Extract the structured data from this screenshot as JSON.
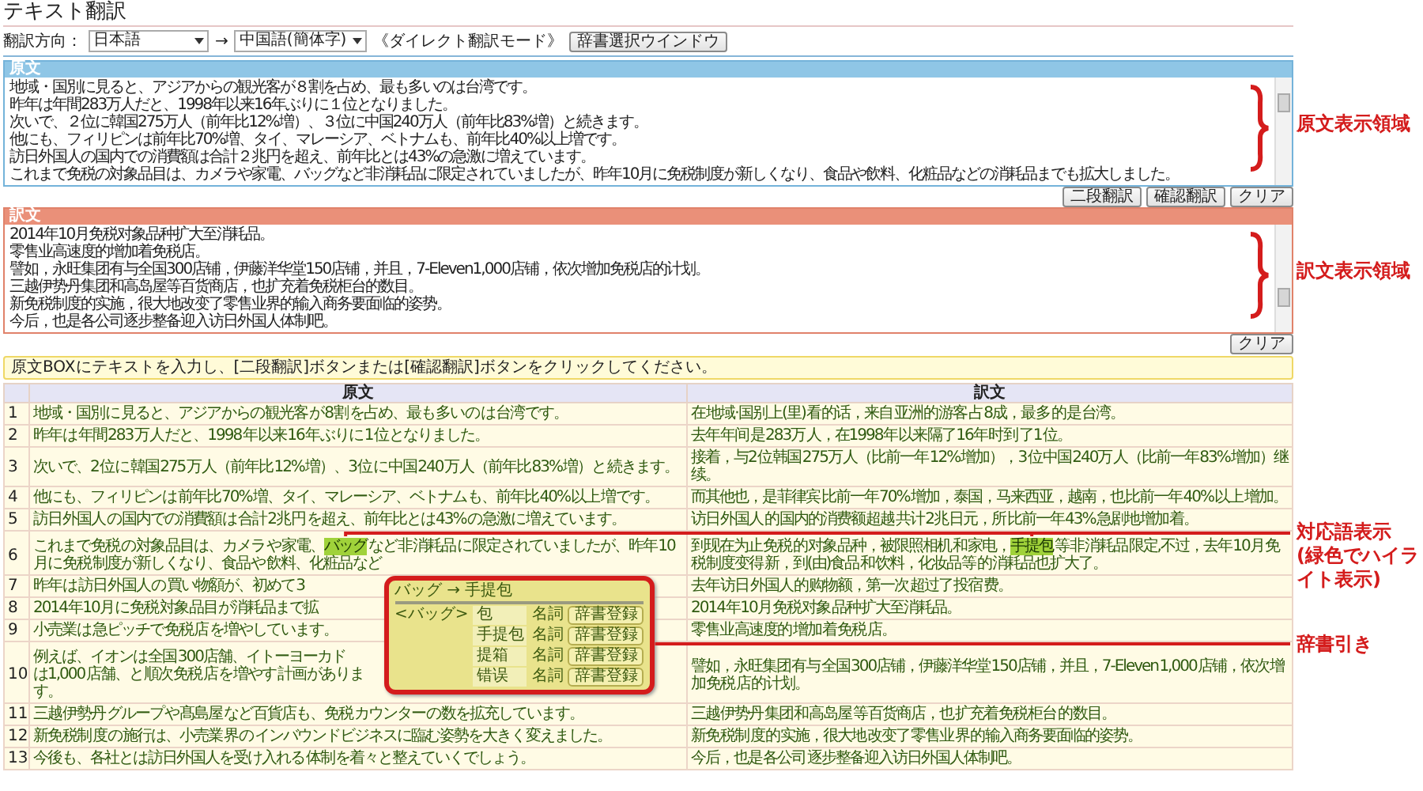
{
  "title": "テキスト翻訳",
  "direction": {
    "label": "翻訳方向：",
    "from": "日本語",
    "arrow": "→",
    "to": "中国語(簡体字)",
    "mode": "《ダイレクト翻訳モード》",
    "dict_button": "辞書選択ウインドウ"
  },
  "source_box": {
    "header": "原文",
    "annotation": "原文表示領域",
    "lines": [
      "地域・国別に見ると、アジアからの観光客が８割を占め、最も多いのは台湾です。",
      "昨年は年間283万人だと、1998年以来16年ぶりに１位となりました。",
      "次いで、２位に韓国275万人（前年比12%増）、３位に中国240万人（前年比83%増）と続きます。",
      "他にも、フィリピンは前年比70%増、タイ、マレーシア、ベトナムも、前年比40%以上増です。",
      "訪日外国人の国内での消費額は合計２兆円を超え、前年比とは43%の急激に増えています。",
      "これまで免税の対象品目は、カメラや家電、バッグなど非消耗品に限定されていましたが、昨年10月に免税制度が新しくなり、食品や飲料、化粧品などの消耗品までも拡大しました。"
    ]
  },
  "source_buttons": [
    "二段翻訳",
    "確認翻訳",
    "クリア"
  ],
  "target_box": {
    "header": "訳文",
    "annotation": "訳文表示領域",
    "lines": [
      "2014年10月免税对象品种扩大至消耗品。",
      "零售业高速度的增加着免税店。",
      "譬如，永旺集团有与全国300店铺，伊藤洋华堂150店铺，并且，7-Eleven1,000店铺，依次增加免税店的计划。",
      "三越伊势丹集团和高岛屋等百货商店，也扩充着免税柜台的数目。",
      "新免税制度的实施，很大地改变了零售业界的输入商务要面临的姿势。",
      "今后，也是各公司逐步整备迎入访日外国人体制吧。"
    ]
  },
  "target_buttons": [
    "クリア"
  ],
  "info": "原文BOXにテキストを入力し、[二段翻訳]ボタンまたは[確認翻訳]ボタンをクリックしてください。",
  "table": {
    "columns": [
      "原文",
      "訳文"
    ],
    "rows": [
      {
        "number": "1",
        "source": [
          {
            "text": "地域・国別 に 見ると、アジア からの 観光客 が 8 割 を占め、最も 多い の は 台湾 です。",
            "highlighted": false
          }
        ],
        "target": [
          {
            "text": "在 地域·国别 上(里) 看 的话，来自 亚洲 的 游客 占 8成，最 多 的 是 台湾。",
            "highlighted": false
          }
        ]
      },
      {
        "number": "2",
        "source": [
          {
            "text": "昨年 は 年間 283 万 人 だと、1998 年 以来 16 年 ぶりに 1 位 となりました。",
            "highlighted": false
          }
        ],
        "target": [
          {
            "text": "去年 年间 是 283万 人，在1998年 以来 隔了16年 时 到 了1 位。",
            "highlighted": false
          }
        ]
      },
      {
        "number": "3",
        "source": [
          {
            "text": "次いで、2 位 に 韓国 275 万 人（前年比 12% 増）、3 位 に 中国 240 万 人（前年比 83% 増）と 続きます。",
            "highlighted": false
          }
        ],
        "target": [
          {
            "text": "接着，与2 位 韩国 275万 人（比前一年 12% 增加），3 位 中国 240万 人（比前一年 83% 增加）继续。",
            "highlighted": false
          }
        ]
      },
      {
        "number": "4",
        "source": [
          {
            "text": "他にも、フィリピン は 前年比 70% 増、タイ、マレーシア、ベトナム も、前年比 40% 以上 増 です。",
            "highlighted": false
          }
        ],
        "target": [
          {
            "text": "而其他也，是 菲律宾 比前一年 70% 增加，泰国，马来西亚，越南，也 比前一年 40% 以上 增加。",
            "highlighted": false
          }
        ]
      },
      {
        "number": "5",
        "source": [
          {
            "text": "訪日 外国人 の 国内での消費額 は 合計 2兆 円 を超え、前年比とは 43% の 急激に 増えています。",
            "highlighted": false
          }
        ],
        "target": [
          {
            "text": "访日 外国人 的 国内的消费额 超越 共计 2兆 日元，所 比前一年 43% 急剧地 增加 着。",
            "highlighted": false
          }
        ]
      },
      {
        "number": "6",
        "source": [
          {
            "text": "これまで 免税 の 対象 品目は、カメラ や 家電、",
            "highlighted": false
          },
          {
            "text": "バッグ",
            "highlighted": true
          },
          {
            "text": " など 非 消耗品 に 限定されていましたが、昨年 10月に 免税 制度が 新しくなり、食品 や 飲料、化粧品 など",
            "highlighted": false
          }
        ],
        "target": [
          {
            "text": "到现在为止 免税 的 对象 品种，被限照相机 和 家电，",
            "highlighted": false
          },
          {
            "text": "手提包",
            "highlighted": true
          },
          {
            "text": " 等 非 消耗品 限定,不过，去年 10月 免税 制度变得 新，到(由)食品 和 饮料，化妆品 等 的 消耗品也 扩大了。",
            "highlighted": false
          }
        ]
      },
      {
        "number": "7",
        "source": [
          {
            "text": "昨年 は 訪日 外国人 の 買い物額が、初めて 3",
            "highlighted": false
          }
        ],
        "target": [
          {
            "text": "去年 访日 外国人 的 购物额，第一次 超过了 投宿 费。",
            "highlighted": false
          }
        ]
      },
      {
        "number": "8",
        "source": [
          {
            "text": "2014 年10月 に 免税 対象 品目 が消耗品まで拡",
            "highlighted": false
          }
        ],
        "target": [
          {
            "text": "2014 年10月 免税 对象 品种 扩大至消耗品。",
            "highlighted": false
          }
        ]
      },
      {
        "number": "9",
        "source": [
          {
            "text": "小売業 は 急ピッチで 免税 店 を増やしています。",
            "highlighted": false
          }
        ],
        "target": [
          {
            "text": "零售业 高速度的 增加 着 免税 店。",
            "highlighted": false
          }
        ]
      },
      {
        "number": "10",
        "source": [
          {
            "text": "例えば、イオンは 全国 300店舗、イトーヨーカド",
            "highlighted": false
          }
        ],
        "source_continued": "は1,000 店舗、と 順次 免税 店 を 増やす 計画 があります。",
        "target": [
          {
            "text": "譬如，永旺集团 有与 全国 300店铺，伊藤洋华堂 150店铺，并且，7-Eleven 1,000 店铺，依次 增加 免税 店 的 计划。",
            "highlighted": false
          }
        ]
      },
      {
        "number": "11",
        "source": [
          {
            "text": "三越 伊勢丹 グループ や 髙島屋 など 百貨店も、免税 カウンター の 数を拡充しています。",
            "highlighted": false
          }
        ],
        "target": [
          {
            "text": "三越 伊势丹 集团 和 高岛屋 等 百货商店，也 扩充着 免税 柜台 的 数目。",
            "highlighted": false
          }
        ]
      },
      {
        "number": "12",
        "source": [
          {
            "text": "新免 税制 度 の 施行は、小売業 界 の インバウンドビジネスに臨む姿勢を大きく 変えました。",
            "highlighted": false
          }
        ],
        "target": [
          {
            "text": "新免 税制 度 的 实施，很大地 改变了 零售业 界 的 输入商务要面临的姿势。",
            "highlighted": false
          }
        ]
      },
      {
        "number": "13",
        "source": [
          {
            "text": "今後も、各社とは 訪日外国人を受け入れる 体制 を着々と整えていくでしょう。",
            "highlighted": false
          }
        ],
        "target": [
          {
            "text": "今后，也是 各公司 逐步整备迎入访日外国人体制吧。",
            "highlighted": false
          }
        ]
      }
    ]
  },
  "popup": {
    "title": "バッグ → 手提包",
    "term": "<バッグ>",
    "entries": [
      {
        "word": "包",
        "pos": "名詞",
        "button": "辞書登録"
      },
      {
        "word": "手提包",
        "pos": "名詞",
        "button": "辞書登録"
      },
      {
        "word": "提箱",
        "pos": "名詞",
        "button": "辞書登録"
      },
      {
        "word": "错误",
        "pos": "名詞",
        "button": "辞書登録"
      }
    ]
  },
  "callouts": {
    "highlight": [
      "対応語表示",
      "(緑色でハイライト表示)"
    ],
    "dictionary": "辞書引き"
  }
}
